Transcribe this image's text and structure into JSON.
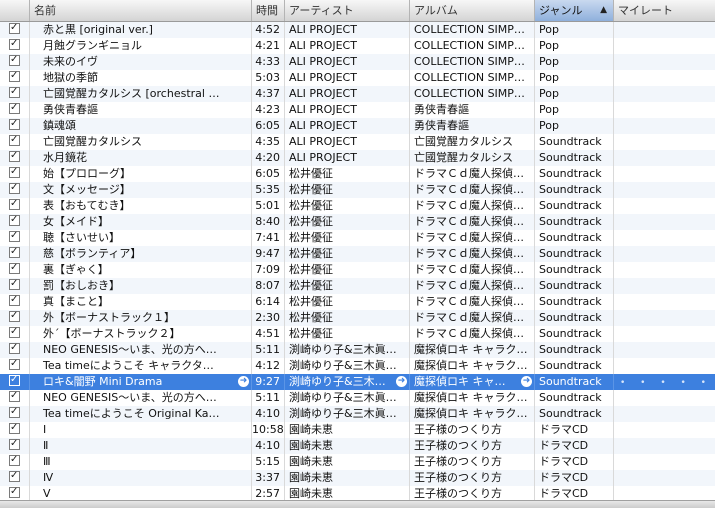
{
  "header": {
    "name": "名前",
    "time": "時間",
    "artist": "アーティスト",
    "album": "アルバム",
    "genre": "ジャンル",
    "rating": "マイレート",
    "sort_arrow": "▲"
  },
  "tracks": [
    {
      "name": "赤と黒 [original ver.]",
      "time": "4:52",
      "artist": "ALI PROJECT",
      "album": "COLLECTION SIMP…",
      "genre": "Pop"
    },
    {
      "name": "月蝕グランギニョル",
      "time": "4:21",
      "artist": "ALI PROJECT",
      "album": "COLLECTION SIMP…",
      "genre": "Pop"
    },
    {
      "name": "未来のイヴ",
      "time": "4:33",
      "artist": "ALI PROJECT",
      "album": "COLLECTION SIMP…",
      "genre": "Pop"
    },
    {
      "name": "地獄の季節",
      "time": "5:03",
      "artist": "ALI PROJECT",
      "album": "COLLECTION SIMP…",
      "genre": "Pop"
    },
    {
      "name": "亡國覚醒カタルシス [orchestral …",
      "time": "4:37",
      "artist": "ALI PROJECT",
      "album": "COLLECTION SIMP…",
      "genre": "Pop"
    },
    {
      "name": "勇侠青春謳",
      "time": "4:23",
      "artist": "ALI PROJECT",
      "album": "勇侠青春謳",
      "genre": "Pop"
    },
    {
      "name": "鎮魂頌",
      "time": "6:05",
      "artist": "ALI PROJECT",
      "album": "勇侠青春謳",
      "genre": "Pop"
    },
    {
      "name": "亡國覚醒カタルシス",
      "time": "4:35",
      "artist": "ALI PROJECT",
      "album": "亡國覚醒カタルシス",
      "genre": "Soundtrack"
    },
    {
      "name": "水月鏡花",
      "time": "4:20",
      "artist": "ALI PROJECT",
      "album": "亡國覚醒カタルシス",
      "genre": "Soundtrack"
    },
    {
      "name": "始【プロローグ】",
      "time": "6:05",
      "artist": "松井優征",
      "album": "ドラマＣｄ魔人探偵…",
      "genre": "Soundtrack"
    },
    {
      "name": "文【メッセージ】",
      "time": "5:35",
      "artist": "松井優征",
      "album": "ドラマＣｄ魔人探偵…",
      "genre": "Soundtrack"
    },
    {
      "name": "表【おもてむき】",
      "time": "5:01",
      "artist": "松井優征",
      "album": "ドラマＣｄ魔人探偵…",
      "genre": "Soundtrack"
    },
    {
      "name": "女【メイド】",
      "time": "8:40",
      "artist": "松井優征",
      "album": "ドラマＣｄ魔人探偵…",
      "genre": "Soundtrack"
    },
    {
      "name": "聴【さいせい】",
      "time": "7:41",
      "artist": "松井優征",
      "album": "ドラマＣｄ魔人探偵…",
      "genre": "Soundtrack"
    },
    {
      "name": "慈【ボランティア】",
      "time": "9:47",
      "artist": "松井優征",
      "album": "ドラマＣｄ魔人探偵…",
      "genre": "Soundtrack"
    },
    {
      "name": "裏【ぎゃく】",
      "time": "7:09",
      "artist": "松井優征",
      "album": "ドラマＣｄ魔人探偵…",
      "genre": "Soundtrack"
    },
    {
      "name": "罰【おしおき】",
      "time": "8:07",
      "artist": "松井優征",
      "album": "ドラマＣｄ魔人探偵…",
      "genre": "Soundtrack"
    },
    {
      "name": "真【まこと】",
      "time": "6:14",
      "artist": "松井優征",
      "album": "ドラマＣｄ魔人探偵…",
      "genre": "Soundtrack"
    },
    {
      "name": "外【ボーナストラック１】",
      "time": "2:30",
      "artist": "松井優征",
      "album": "ドラマＣｄ魔人探偵…",
      "genre": "Soundtrack"
    },
    {
      "name": "外´【ボーナストラック２】",
      "time": "4:51",
      "artist": "松井優征",
      "album": "ドラマＣｄ魔人探偵…",
      "genre": "Soundtrack"
    },
    {
      "name": "NEO GENESIS〜いま、光の方へ…",
      "time": "5:11",
      "artist": "渕崎ゆり子&三木眞…",
      "album": "魔探偵ロキ キャラク…",
      "genre": "Soundtrack"
    },
    {
      "name": "Tea timeにようこそ キャラクタ…",
      "time": "4:12",
      "artist": "渕崎ゆり子&三木眞…",
      "album": "魔探偵ロキ キャラク…",
      "genre": "Soundtrack"
    },
    {
      "name": "ロキ&闇野 Mini Drama",
      "time": "9:27",
      "artist": "渕崎ゆり子&三木…",
      "album": "魔探偵ロキ キャ…",
      "genre": "Soundtrack",
      "selected": true
    },
    {
      "name": "NEO GENESIS〜いま、光の方へ…",
      "time": "5:11",
      "artist": "渕崎ゆり子&三木眞…",
      "album": "魔探偵ロキ キャラク…",
      "genre": "Soundtrack"
    },
    {
      "name": "Tea timeにようこそ Original Ka…",
      "time": "4:10",
      "artist": "渕崎ゆり子&三木眞…",
      "album": "魔探偵ロキ キャラク…",
      "genre": "Soundtrack"
    },
    {
      "name": "Ⅰ",
      "time": "10:58",
      "artist": "園崎未恵",
      "album": "王子様のつくり方",
      "genre": "ドラマCD"
    },
    {
      "name": "Ⅱ",
      "time": "4:10",
      "artist": "園崎未恵",
      "album": "王子様のつくり方",
      "genre": "ドラマCD"
    },
    {
      "name": "Ⅲ",
      "time": "5:15",
      "artist": "園崎未恵",
      "album": "王子様のつくり方",
      "genre": "ドラマCD"
    },
    {
      "name": "Ⅳ",
      "time": "3:37",
      "artist": "園崎未恵",
      "album": "王子様のつくり方",
      "genre": "ドラマCD"
    },
    {
      "name": "Ⅴ",
      "time": "2:57",
      "artist": "園崎未恵",
      "album": "王子様のつくり方",
      "genre": "ドラマCD"
    }
  ],
  "selected_rating_dots": "• • • • •",
  "selected_arrow": "➜",
  "colors": {
    "selection": "#3d80df",
    "odd_row": "#f2f6fb",
    "sorted_header": "#8fb0dc"
  },
  "icons": {
    "checkbox": "checkbox-checked-icon",
    "go_arrow": "go-arrow-icon"
  }
}
